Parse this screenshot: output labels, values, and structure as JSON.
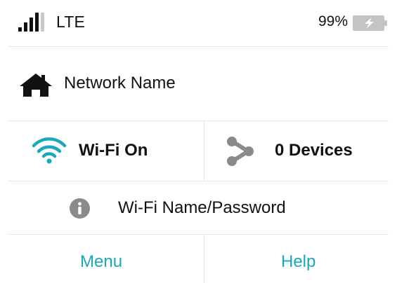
{
  "status_bar": {
    "network_type": "LTE",
    "signal_bars": 4,
    "battery_percent": "99%",
    "battery_charging": true
  },
  "network": {
    "name": "Network Name",
    "icon": "home-icon"
  },
  "wifi": {
    "label": "Wi-Fi On",
    "icon": "wifi-icon"
  },
  "devices": {
    "label": "0 Devices",
    "icon": "share-icon"
  },
  "info": {
    "label": "Wi-Fi Name/Password",
    "icon": "info-icon"
  },
  "footer": {
    "menu_label": "Menu",
    "help_label": "Help"
  },
  "colors": {
    "accent": "#1aa8bd",
    "icon_gray": "#8a8a8a",
    "text": "#111111",
    "divider": "#e6e6e6"
  }
}
